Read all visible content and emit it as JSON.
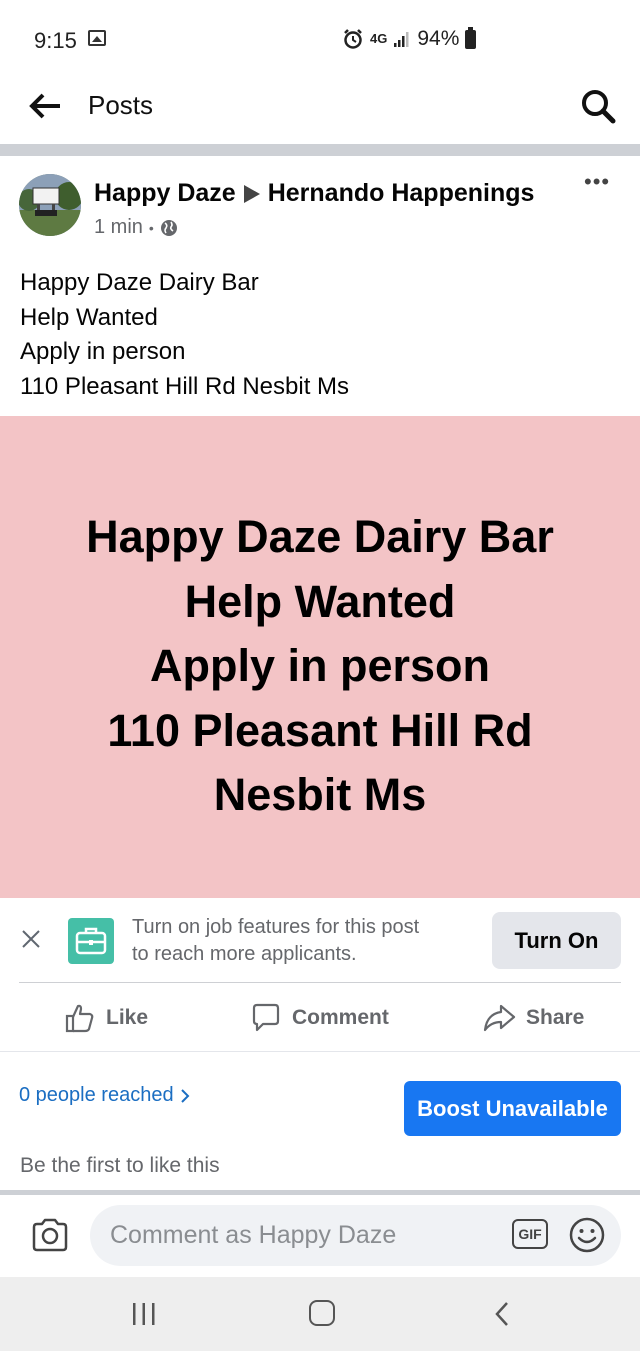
{
  "status_bar": {
    "time": "9:15",
    "network": "4G",
    "battery": "94%",
    "icons": [
      "image-icon",
      "alarm-icon",
      "signal-icon",
      "battery-icon"
    ]
  },
  "header": {
    "title": "Posts",
    "back_icon": "arrow-left-icon",
    "search_icon": "search-icon"
  },
  "post": {
    "author": "Happy Daze",
    "group": "Hernando Happenings",
    "time": "1 min",
    "privacy_icon": "globe-icon",
    "more_icon": "more-dots-icon",
    "text_lines": [
      "Happy Daze Dairy Bar",
      "Help Wanted",
      "Apply in person",
      "110 Pleasant Hill Rd Nesbit Ms"
    ],
    "image": {
      "background": "#f3c4c6",
      "lines": [
        "Happy Daze Dairy Bar",
        "Help Wanted",
        "Apply in person",
        "110 Pleasant Hill Rd",
        "Nesbit Ms"
      ]
    }
  },
  "job_features": {
    "text_line1": "Turn on job features for this post",
    "text_line2": "to reach more applicants.",
    "button": "Turn On",
    "icon": "briefcase-icon",
    "icon_color": "#45bfa7"
  },
  "actions": {
    "like": "Like",
    "comment": "Comment",
    "share": "Share"
  },
  "reach": {
    "text": "0 people reached",
    "boost": "Boost Unavailable",
    "boost_color": "#1877f2"
  },
  "likes_text": "Be the first to like this",
  "comment_bar": {
    "placeholder": "Comment as Happy Daze",
    "gif": "GIF"
  },
  "nav_bar": {
    "icons": [
      "recents-icon",
      "home-icon",
      "back-icon"
    ]
  }
}
